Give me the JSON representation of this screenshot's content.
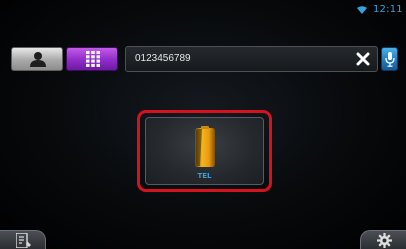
{
  "status_bar": {
    "wifi_icon": "wifi-icon",
    "time": "12:11"
  },
  "top_row": {
    "contacts_icon": "person-icon",
    "dialpad_icon": "keypad-icon",
    "number_field_value": "0123456789",
    "clear_icon": "close-icon",
    "voice_icon": "microphone-icon"
  },
  "main": {
    "tile_icon": "phone-icon",
    "tile_label": "TEL",
    "highlight_color": "#d6121e"
  },
  "bottom_bar": {
    "menu_icon": "menu-icon",
    "settings_icon": "gear-icon"
  },
  "colors": {
    "accent_blue": "#3aa0d8",
    "dialpad_purple": "#8f2cc8",
    "voice_blue": "#1f78bd"
  }
}
